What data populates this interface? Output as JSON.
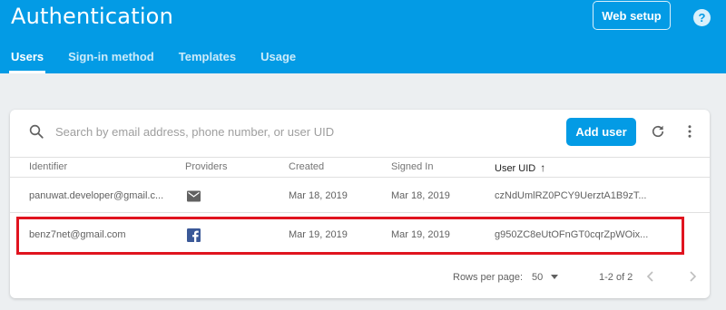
{
  "header": {
    "title": "Authentication",
    "web_setup_label": "Web setup",
    "help_symbol": "?",
    "tabs": [
      {
        "label": "Users",
        "active": true
      },
      {
        "label": "Sign-in method",
        "active": false
      },
      {
        "label": "Templates",
        "active": false
      },
      {
        "label": "Usage",
        "active": false
      }
    ]
  },
  "toolbar": {
    "search_placeholder": "Search by email address, phone number, or user UID",
    "add_user_label": "Add user",
    "icons": [
      "search-icon",
      "refresh-icon",
      "more-vert-icon"
    ]
  },
  "table": {
    "columns": [
      "Identifier",
      "Providers",
      "Created",
      "Signed In",
      "User UID"
    ],
    "sorted_column": "User UID",
    "sort_direction": "ascending",
    "rows": [
      {
        "identifier": "panuwat.developer@gmail.c...",
        "provider": "email-icon",
        "created": "Mar 18, 2019",
        "signed_in": "Mar 18, 2019",
        "uid": "czNdUmlRZ0PCY9UerztA1B9zT..."
      },
      {
        "identifier": "benz7net@gmail.com",
        "provider": "facebook-icon",
        "created": "Mar 19, 2019",
        "signed_in": "Mar 19, 2019",
        "uid": "g950ZC8eUtOFnGT0cqrZpWOix...",
        "highlighted": true
      }
    ]
  },
  "pagination": {
    "rows_per_page_label": "Rows per page:",
    "rows_per_page_value": "50",
    "range_label": "1-2 of 2"
  },
  "colors": {
    "brand_blue": "#039be5",
    "page_background": "#eceff1",
    "highlight_red": "#e0141f",
    "facebook_blue": "#3b5998"
  }
}
